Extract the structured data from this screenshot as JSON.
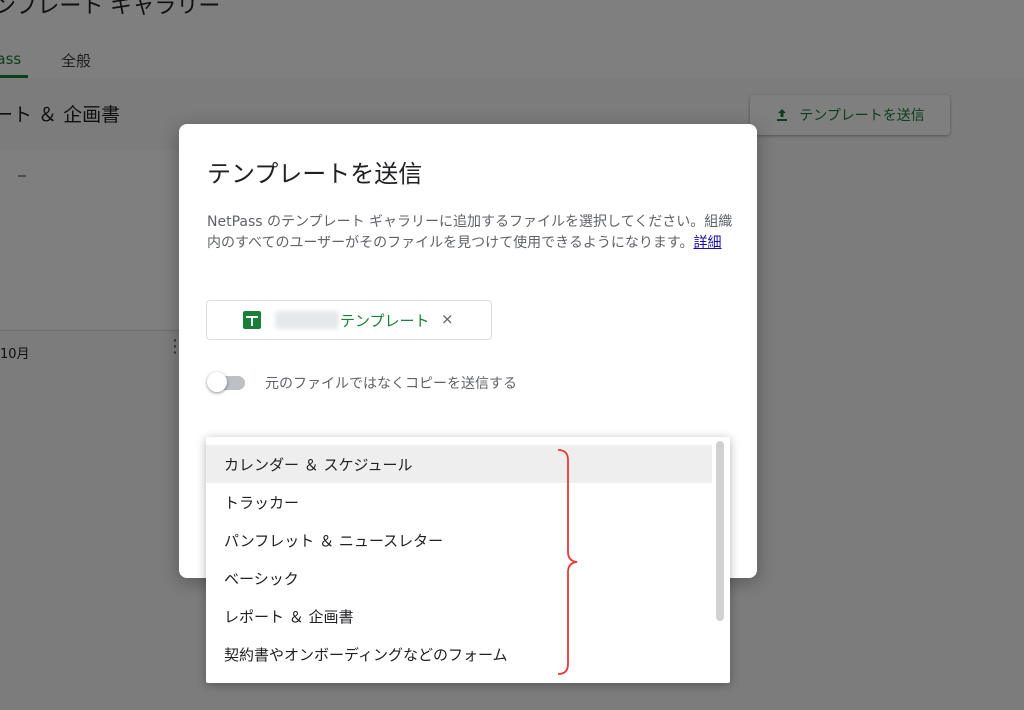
{
  "background": {
    "header_title": "ンプレート ギャラリー",
    "tabs": [
      {
        "label": "Pass"
      },
      {
        "label": "全般"
      }
    ],
    "section_title": "ート ＆ 企画書",
    "submit_button": {
      "label": "テンプレートを送信",
      "icon": "upload-icon"
    },
    "card": {
      "meta": "10月",
      "more_icon": "more-vert-icon"
    }
  },
  "dialog": {
    "title": "テンプレートを送信",
    "description": "NetPass のテンプレート ギャラリーに追加するファイルを選択してください。組織内のすべてのユーザーがそのファイルを見つけて使用できるようになります。",
    "details_link": "詳細",
    "file_chip": {
      "name": "テンプレート",
      "remove": "×",
      "icon": "sheets-icon"
    },
    "toggle": {
      "label": "元のファイルではなくコピーを送信する",
      "on": false
    }
  },
  "dropdown": {
    "items": [
      {
        "label": "カレンダー ＆ スケジュール",
        "highlighted": true
      },
      {
        "label": "トラッカー"
      },
      {
        "label": "パンフレット ＆ ニュースレター"
      },
      {
        "label": "ベーシック"
      },
      {
        "label": "レポート ＆ 企画書"
      },
      {
        "label": "契約書やオンボーディングなどのフォーム"
      }
    ]
  },
  "colors": {
    "accent_green": "#188038",
    "link_blue": "#1a0dab",
    "annotation_red": "#e53935"
  }
}
